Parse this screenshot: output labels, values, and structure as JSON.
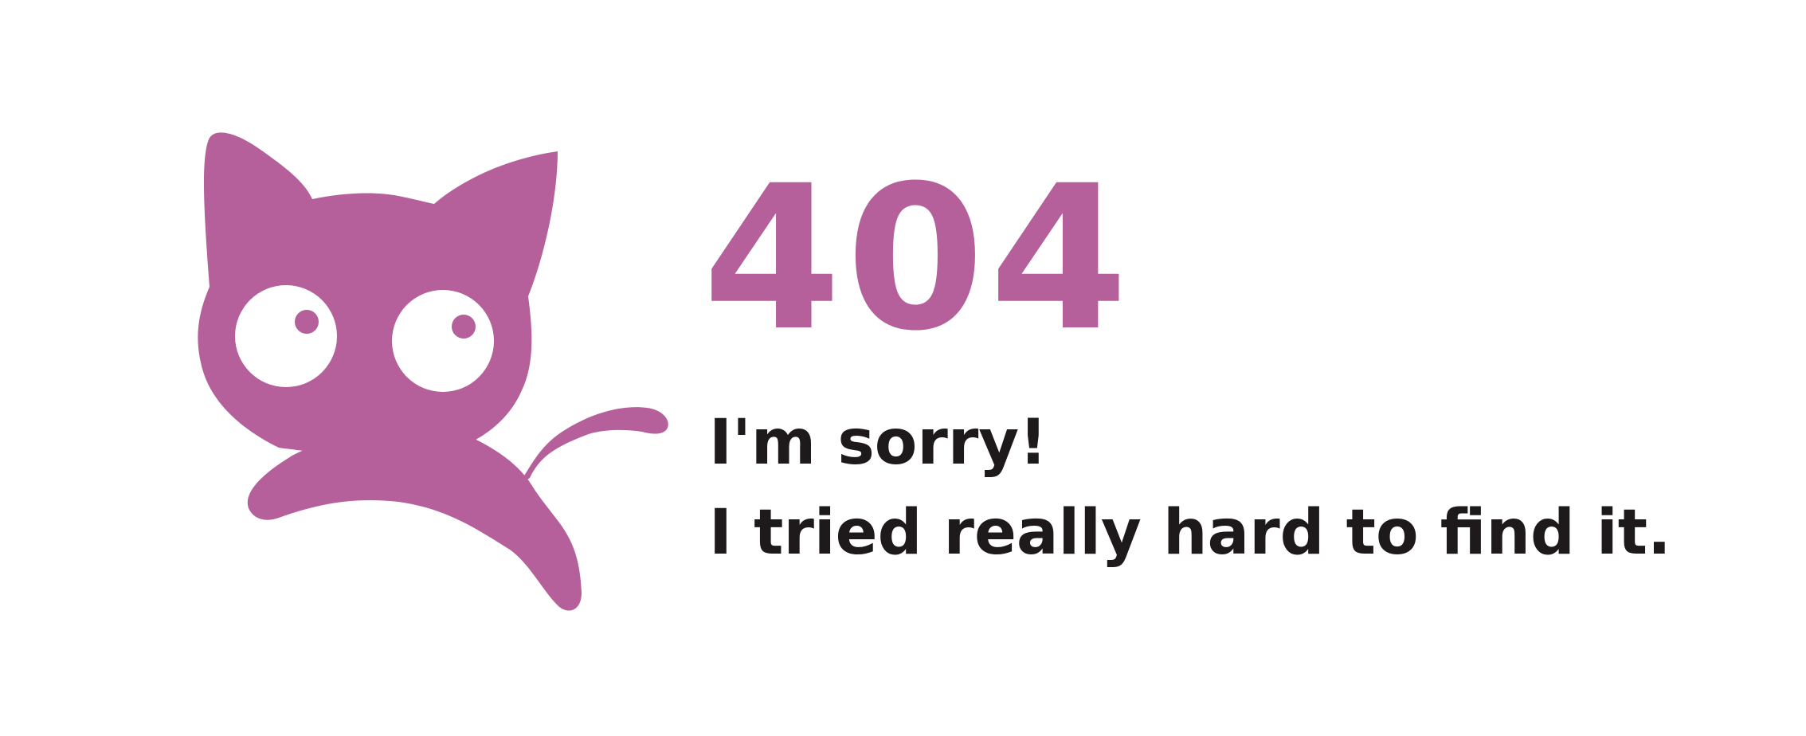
{
  "colors": {
    "accent": "#b5609a",
    "text": "#1e1a1b",
    "background": "#ffffff"
  },
  "illustration": {
    "icon": "cat-icon"
  },
  "error": {
    "code": "404",
    "line1": "I'm sorry!",
    "line2": "I tried really hard to find it."
  }
}
